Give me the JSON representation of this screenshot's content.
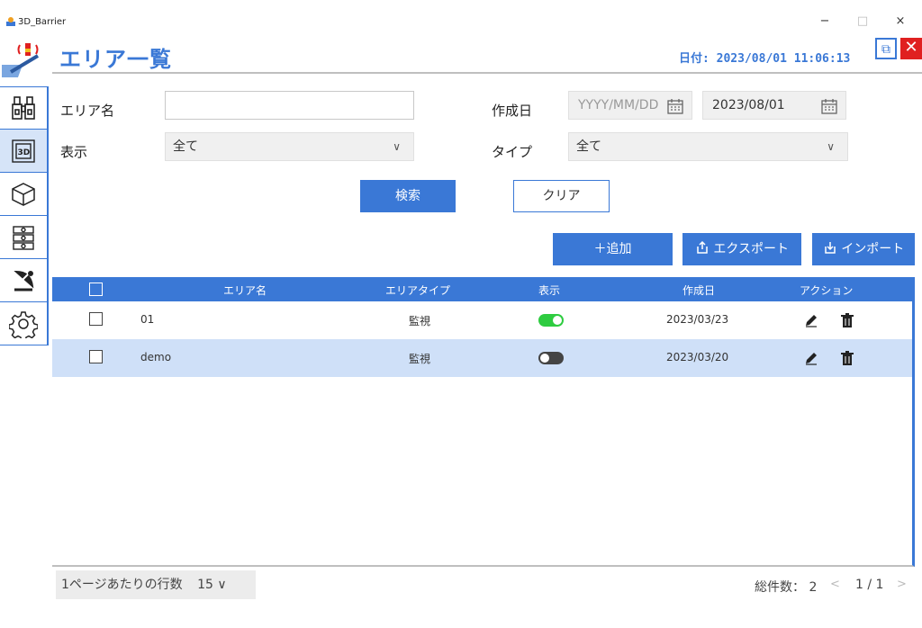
{
  "window": {
    "title": "3D_Barrier",
    "minimize": "−",
    "maximize": "□",
    "close": "×"
  },
  "header": {
    "title": "エリア一覧",
    "date_label": "日付: 2023/08/01 11:06:13",
    "popout_icon": "⧉",
    "close_icon": "✕"
  },
  "sidebar": {
    "items": [
      {
        "icon": "binoculars-icon"
      },
      {
        "icon": "3d-view-icon",
        "active": true
      },
      {
        "icon": "cube-icon"
      },
      {
        "icon": "signal-tower-icon"
      },
      {
        "icon": "satellite-dish-icon"
      },
      {
        "icon": "gear-icon"
      }
    ]
  },
  "filters": {
    "area_name_label": "エリア名",
    "area_name_value": "",
    "display_label": "表示",
    "display_value": "全て",
    "created_label": "作成日",
    "created_from_placeholder": "YYYY/MM/DD",
    "created_to_value": "2023/08/01",
    "type_label": "タイプ",
    "type_value": "全て"
  },
  "buttons": {
    "search": "検索",
    "clear": "クリア",
    "add": "＋追加",
    "export": "エクスポート",
    "import": "インポート"
  },
  "table": {
    "columns": [
      "エリア名",
      "エリアタイプ",
      "表示",
      "作成日",
      "アクション"
    ],
    "rows": [
      {
        "name": "01",
        "type": "監視",
        "display": true,
        "created": "2023/03/23",
        "selected": false
      },
      {
        "name": "demo",
        "type": "監視",
        "display": false,
        "created": "2023/03/20",
        "selected": true
      }
    ]
  },
  "footer": {
    "rows_per_page_label": "1ページあたりの行数",
    "rows_per_page_value": "15 ∨",
    "total": "総件数： 2",
    "prev": "<",
    "page": "1 / 1",
    "next": ">"
  },
  "colors": {
    "accent": "#3a78d6",
    "toggle_on": "#2ecc40",
    "close_red": "#e02020",
    "row_selected": "#cfe0f8"
  }
}
